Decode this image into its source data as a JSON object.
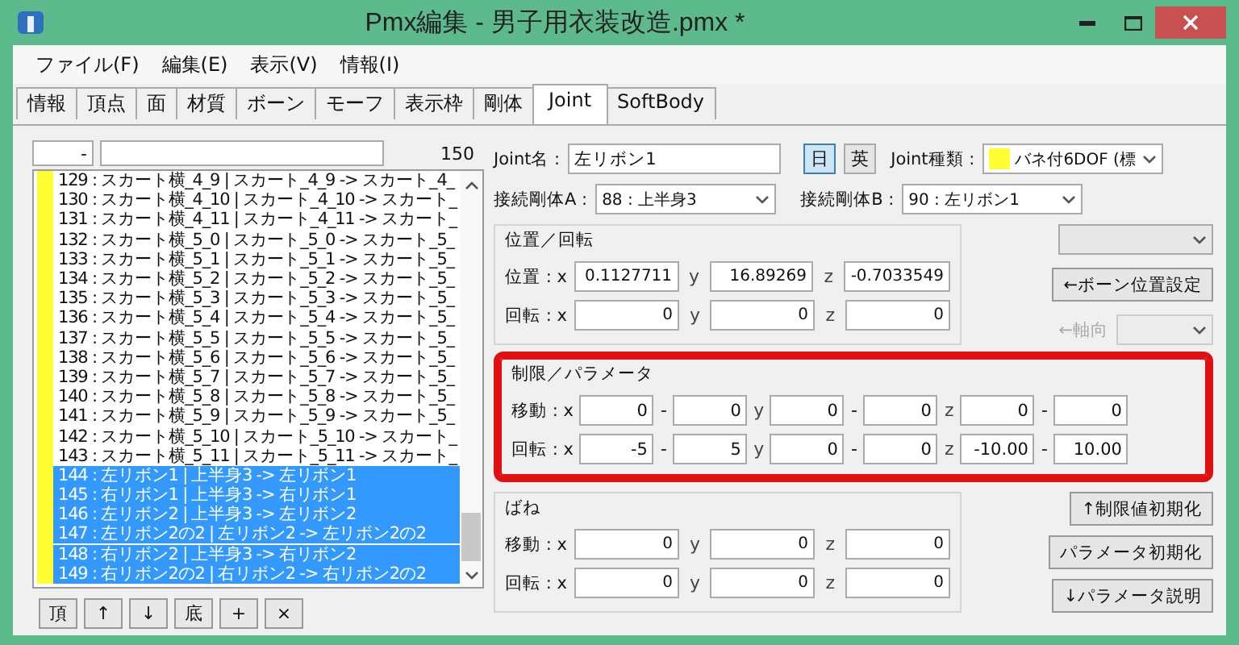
{
  "window": {
    "title": "Pmx編集 - 男子用衣装改造.pmx *"
  },
  "menu": [
    "ファイル(F)",
    "編集(E)",
    "表示(V)",
    "情報(I)"
  ],
  "tabs": [
    {
      "label": "情報",
      "selected": false
    },
    {
      "label": "頂点",
      "selected": false
    },
    {
      "label": "面",
      "selected": false
    },
    {
      "label": "材質",
      "selected": false
    },
    {
      "label": "ボーン",
      "selected": false
    },
    {
      "label": "モーフ",
      "selected": false
    },
    {
      "label": "表示枠",
      "selected": false
    },
    {
      "label": "剛体",
      "selected": false
    },
    {
      "label": "Joint",
      "selected": true
    },
    {
      "label": "SoftBody",
      "selected": false
    }
  ],
  "list": {
    "range_sep": "-",
    "count": "150",
    "items": [
      {
        "text": "129 : スカート横_4_9 | スカート_4_9 -> スカート_4_",
        "selected": false
      },
      {
        "text": "130 : スカート横_4_10 | スカート_4_10 -> スカート_",
        "selected": false
      },
      {
        "text": "131 : スカート横_4_11 | スカート_4_11 -> スカート_",
        "selected": false
      },
      {
        "text": "132 : スカート横_5_0 | スカート_5_0 -> スカート_5_",
        "selected": false
      },
      {
        "text": "133 : スカート横_5_1 | スカート_5_1 -> スカート_5_",
        "selected": false
      },
      {
        "text": "134 : スカート横_5_2 | スカート_5_2 -> スカート_5_",
        "selected": false
      },
      {
        "text": "135 : スカート横_5_3 | スカート_5_3 -> スカート_5_",
        "selected": false
      },
      {
        "text": "136 : スカート横_5_4 | スカート_5_4 -> スカート_5_",
        "selected": false
      },
      {
        "text": "137 : スカート横_5_5 | スカート_5_5 -> スカート_5_",
        "selected": false
      },
      {
        "text": "138 : スカート横_5_6 | スカート_5_6 -> スカート_5_",
        "selected": false
      },
      {
        "text": "139 : スカート横_5_7 | スカート_5_7 -> スカート_5_",
        "selected": false
      },
      {
        "text": "140 : スカート横_5_8 | スカート_5_8 -> スカート_5_",
        "selected": false
      },
      {
        "text": "141 : スカート横_5_9 | スカート_5_9 -> スカート_5_",
        "selected": false
      },
      {
        "text": "142 : スカート横_5_10 | スカート_5_10 -> スカート_",
        "selected": false
      },
      {
        "text": "143 : スカート横_5_11 | スカート_5_11 -> スカート_",
        "selected": false
      },
      {
        "text": "144 : 左リボン1 | 上半身3 -> 左リボン1",
        "selected": true
      },
      {
        "text": "145 : 右リボン1 | 上半身3 -> 右リボン1",
        "selected": true
      },
      {
        "text": "146 : 左リボン2 | 上半身3 -> 左リボン2",
        "selected": true
      },
      {
        "text": "147 : 左リボン2の2 | 左リボン2 -> 左リボン2の2",
        "selected": true
      },
      {
        "text": "148 : 右リボン2 | 上半身3 -> 右リボン2",
        "selected": true
      },
      {
        "text": "149 : 右リボン2の2 | 右リボン2 -> 右リボン2の2",
        "selected": true
      }
    ],
    "buttons": [
      "頂",
      "↑",
      "↓",
      "底",
      "+",
      "×"
    ]
  },
  "joint": {
    "name_label": "Joint名 :",
    "name": "左リボン1",
    "lang": [
      {
        "label": "日",
        "selected": true
      },
      {
        "label": "英",
        "selected": false
      }
    ],
    "type_label": "Joint種類 :",
    "type": "バネ付6DOF (標",
    "body_a_label": "接続剛体A :",
    "body_a": "88 : 上半身3",
    "body_b_label": "接続剛体B :",
    "body_b": "90 : 左リボン1"
  },
  "position": {
    "title": "位置／回転",
    "rows": [
      {
        "label": "位置 : x",
        "fields": [
          {
            "value": "0.1127711"
          },
          {
            "axis": "y",
            "value": "16.89269"
          },
          {
            "axis": "z",
            "value": "-0.7033549"
          }
        ]
      },
      {
        "label": "回転 : x",
        "fields": [
          {
            "value": "0"
          },
          {
            "axis": "y",
            "value": "0"
          },
          {
            "axis": "z",
            "value": "0"
          }
        ]
      }
    ]
  },
  "side": {
    "bone_button": "←ボーン位置設定",
    "axis_label": "←軸向",
    "axis_disabled": true
  },
  "limits": {
    "title": "制限／パラメータ",
    "highlighted": true,
    "rows": [
      {
        "label": "移動 : x",
        "pairs": [
          {
            "min": "0",
            "sep": "-",
            "max": "0"
          },
          {
            "axis": "y",
            "min": "0",
            "sep": "-",
            "max": "0"
          },
          {
            "axis": "z",
            "min": "0",
            "sep": "-",
            "max": "0"
          }
        ]
      },
      {
        "label": "回転 : x",
        "pairs": [
          {
            "min": "-5",
            "sep": "-",
            "max": "5"
          },
          {
            "axis": "y",
            "min": "0",
            "sep": "-",
            "max": "0"
          },
          {
            "axis": "z",
            "min": "-10.00",
            "sep": "-",
            "max": "10.00"
          }
        ]
      }
    ]
  },
  "spring": {
    "title": "ばね",
    "rows": [
      {
        "label": "移動 : x",
        "fields": [
          {
            "value": "0"
          },
          {
            "axis": "y",
            "value": "0"
          },
          {
            "axis": "z",
            "value": "0"
          }
        ]
      },
      {
        "label": "回転 : x",
        "fields": [
          {
            "value": "0"
          },
          {
            "axis": "y",
            "value": "0"
          },
          {
            "axis": "z",
            "value": "0"
          }
        ]
      }
    ]
  },
  "side_buttons": [
    "↑制限値初期化",
    "パラメータ初期化",
    "↓パラメータ説明"
  ]
}
